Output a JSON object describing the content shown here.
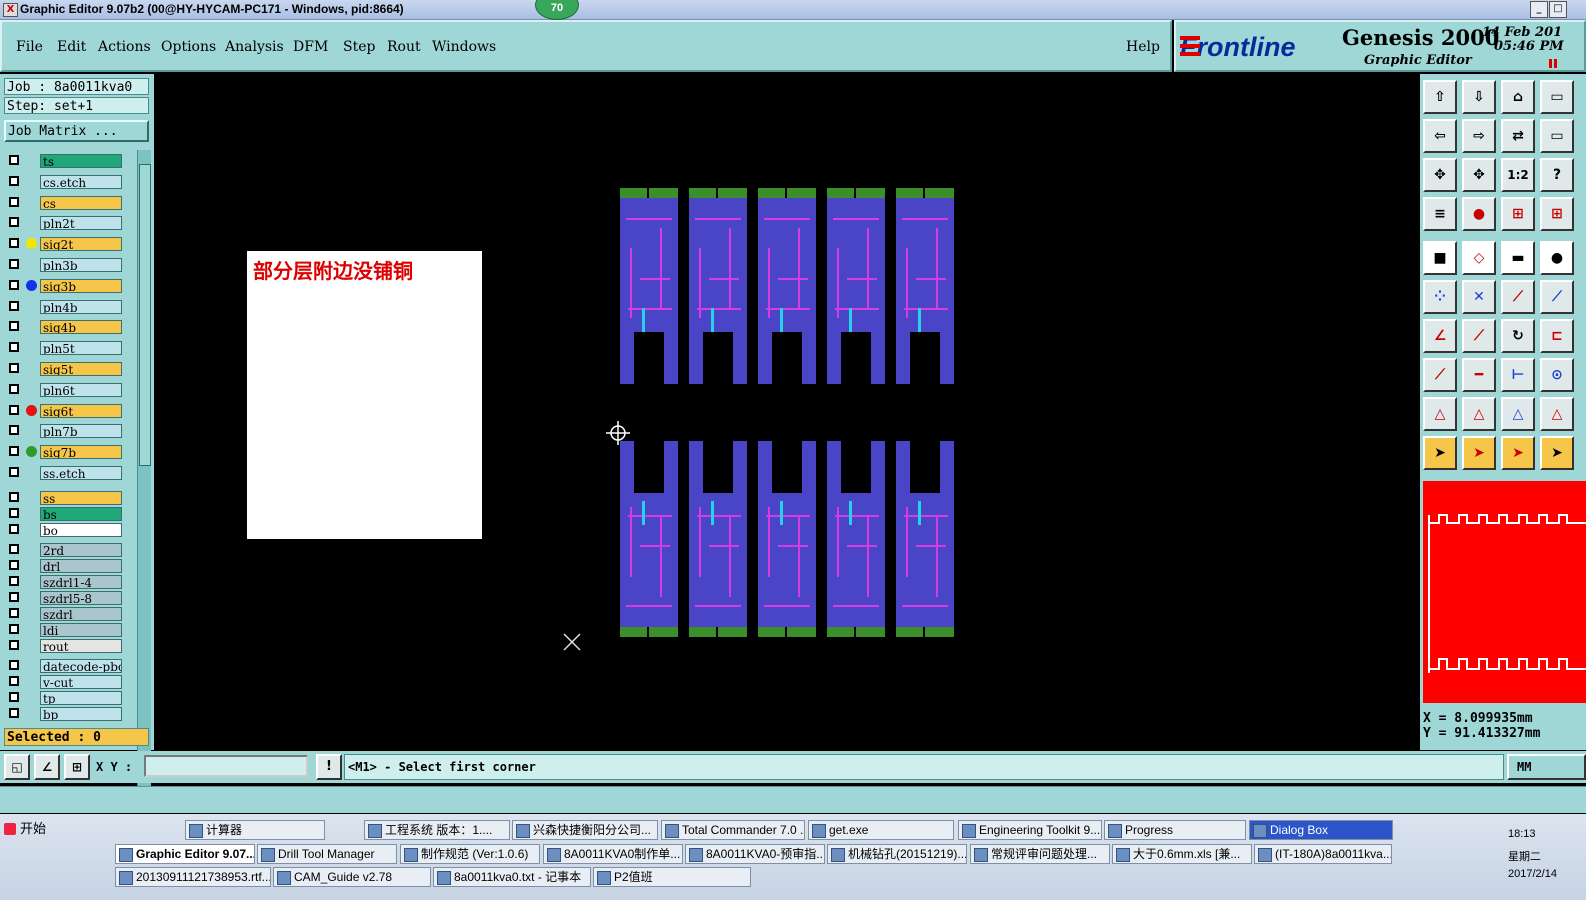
{
  "window": {
    "title": "Graphic Editor 9.07b2 (00@HY-HYCAM-PC171 - Windows, pid:8664)",
    "badge": "70",
    "btn_min": "_",
    "btn_max": "□"
  },
  "menu": {
    "items": [
      "File",
      "Edit",
      "Actions",
      "Options",
      "Analysis",
      "DFM",
      "Step",
      "Rout",
      "Windows"
    ],
    "help": "Help"
  },
  "brand": {
    "logo": "Frontline",
    "product": "Genesis 2000",
    "subtitle": "Graphic Editor",
    "date": "14 Feb 201",
    "time": "05:46 PM"
  },
  "left": {
    "job": "Job : 8a0011kva0",
    "step": "Step: set+1",
    "job_matrix": "Job Matrix ...",
    "layers": [
      {
        "name": "ts",
        "color": "#20a878",
        "dot": ""
      },
      {
        "name": "cs.etch",
        "color": "#bfe3ea",
        "dot": ""
      },
      {
        "name": "cs",
        "color": "#f5c64a",
        "dot": ""
      },
      {
        "name": "pln2t",
        "color": "#bfe3ea",
        "dot": ""
      },
      {
        "name": "sig2t",
        "color": "#f5c64a",
        "dot": "#f2e600"
      },
      {
        "name": "pln3b",
        "color": "#bfe3ea",
        "dot": ""
      },
      {
        "name": "sig3b",
        "color": "#f5c64a",
        "dot": "#1033e6"
      },
      {
        "name": "pln4b",
        "color": "#bfe3ea",
        "dot": ""
      },
      {
        "name": "sig4b",
        "color": "#f5c64a",
        "dot": ""
      },
      {
        "name": "pln5t",
        "color": "#bfe3ea",
        "dot": ""
      },
      {
        "name": "sig5t",
        "color": "#f5c64a",
        "dot": ""
      },
      {
        "name": "pln6t",
        "color": "#bfe3ea",
        "dot": ""
      },
      {
        "name": "sig6t",
        "color": "#f5c64a",
        "dot": "#e61010"
      },
      {
        "name": "pln7b",
        "color": "#bfe3ea",
        "dot": ""
      },
      {
        "name": "sig7b",
        "color": "#f5c64a",
        "dot": "#2f9a2a"
      },
      {
        "name": "ss.etch",
        "color": "#bfe3ea",
        "dot": ""
      },
      {
        "name": "ss",
        "color": "#f5c64a",
        "dot": ""
      },
      {
        "name": "bs",
        "color": "#20a878",
        "dot": ""
      },
      {
        "name": "bo",
        "color": "#ffffff",
        "dot": ""
      },
      {
        "name": "2rd",
        "color": "#a9c6cc",
        "dot": ""
      },
      {
        "name": "drl",
        "color": "#a9c6cc",
        "dot": ""
      },
      {
        "name": "szdrl1-4",
        "color": "#a9c6cc",
        "dot": ""
      },
      {
        "name": "szdrl5-8",
        "color": "#a9c6cc",
        "dot": ""
      },
      {
        "name": "szdrl",
        "color": "#a9c6cc",
        "dot": ""
      },
      {
        "name": "ldi",
        "color": "#a9c6cc",
        "dot": ""
      },
      {
        "name": "rout",
        "color": "#e4e4e4",
        "dot": ""
      },
      {
        "name": "datecode-pbc",
        "color": "#bfe3ea",
        "dot": ""
      },
      {
        "name": "v-cut",
        "color": "#bfe3ea",
        "dot": ""
      },
      {
        "name": "tp",
        "color": "#bfe3ea",
        "dot": ""
      },
      {
        "name": "bp",
        "color": "#bfe3ea",
        "dot": ""
      }
    ],
    "selected": "Selected : 0"
  },
  "canvas": {
    "note": "部分层附边没铺铜"
  },
  "tools": {
    "one_two": "1:2",
    "question": "?"
  },
  "coords": {
    "x": "X = 8.099935mm",
    "y": "Y = 91.413327mm"
  },
  "command": {
    "xy_label": "X Y :",
    "xy_value": "",
    "prompt": "<M1> - Select first corner",
    "unit": "MM",
    "bang": "!"
  },
  "taskbar": {
    "start": "开始",
    "row1": [
      "计算器",
      "工程系统  版本：1....",
      "兴森快捷衡阳分公司...",
      "Total Commander 7.0 ...",
      "get.exe",
      "Engineering Toolkit 9....",
      "Progress",
      "Dialog Box"
    ],
    "row2": [
      "Graphic Editor 9.07...",
      "Drill Tool Manager",
      "制作规范 (Ver:1.0.6)",
      "8A0011KVA0制作单...",
      "8A0011KVA0-预审指...",
      "机械钻孔(20151219)...",
      "常规评审问题处理...",
      "大于0.6mm.xls [兼...",
      "(IT-180A)8a0011kva..."
    ],
    "row3": [
      "20130911121738953.rtf...",
      "CAM_Guide v2.78",
      "8a0011kva0.txt - 记事本",
      "P2值班"
    ],
    "clock_time": "18:13",
    "clock_day": "星期二",
    "clock_date": "2017/2/14"
  }
}
